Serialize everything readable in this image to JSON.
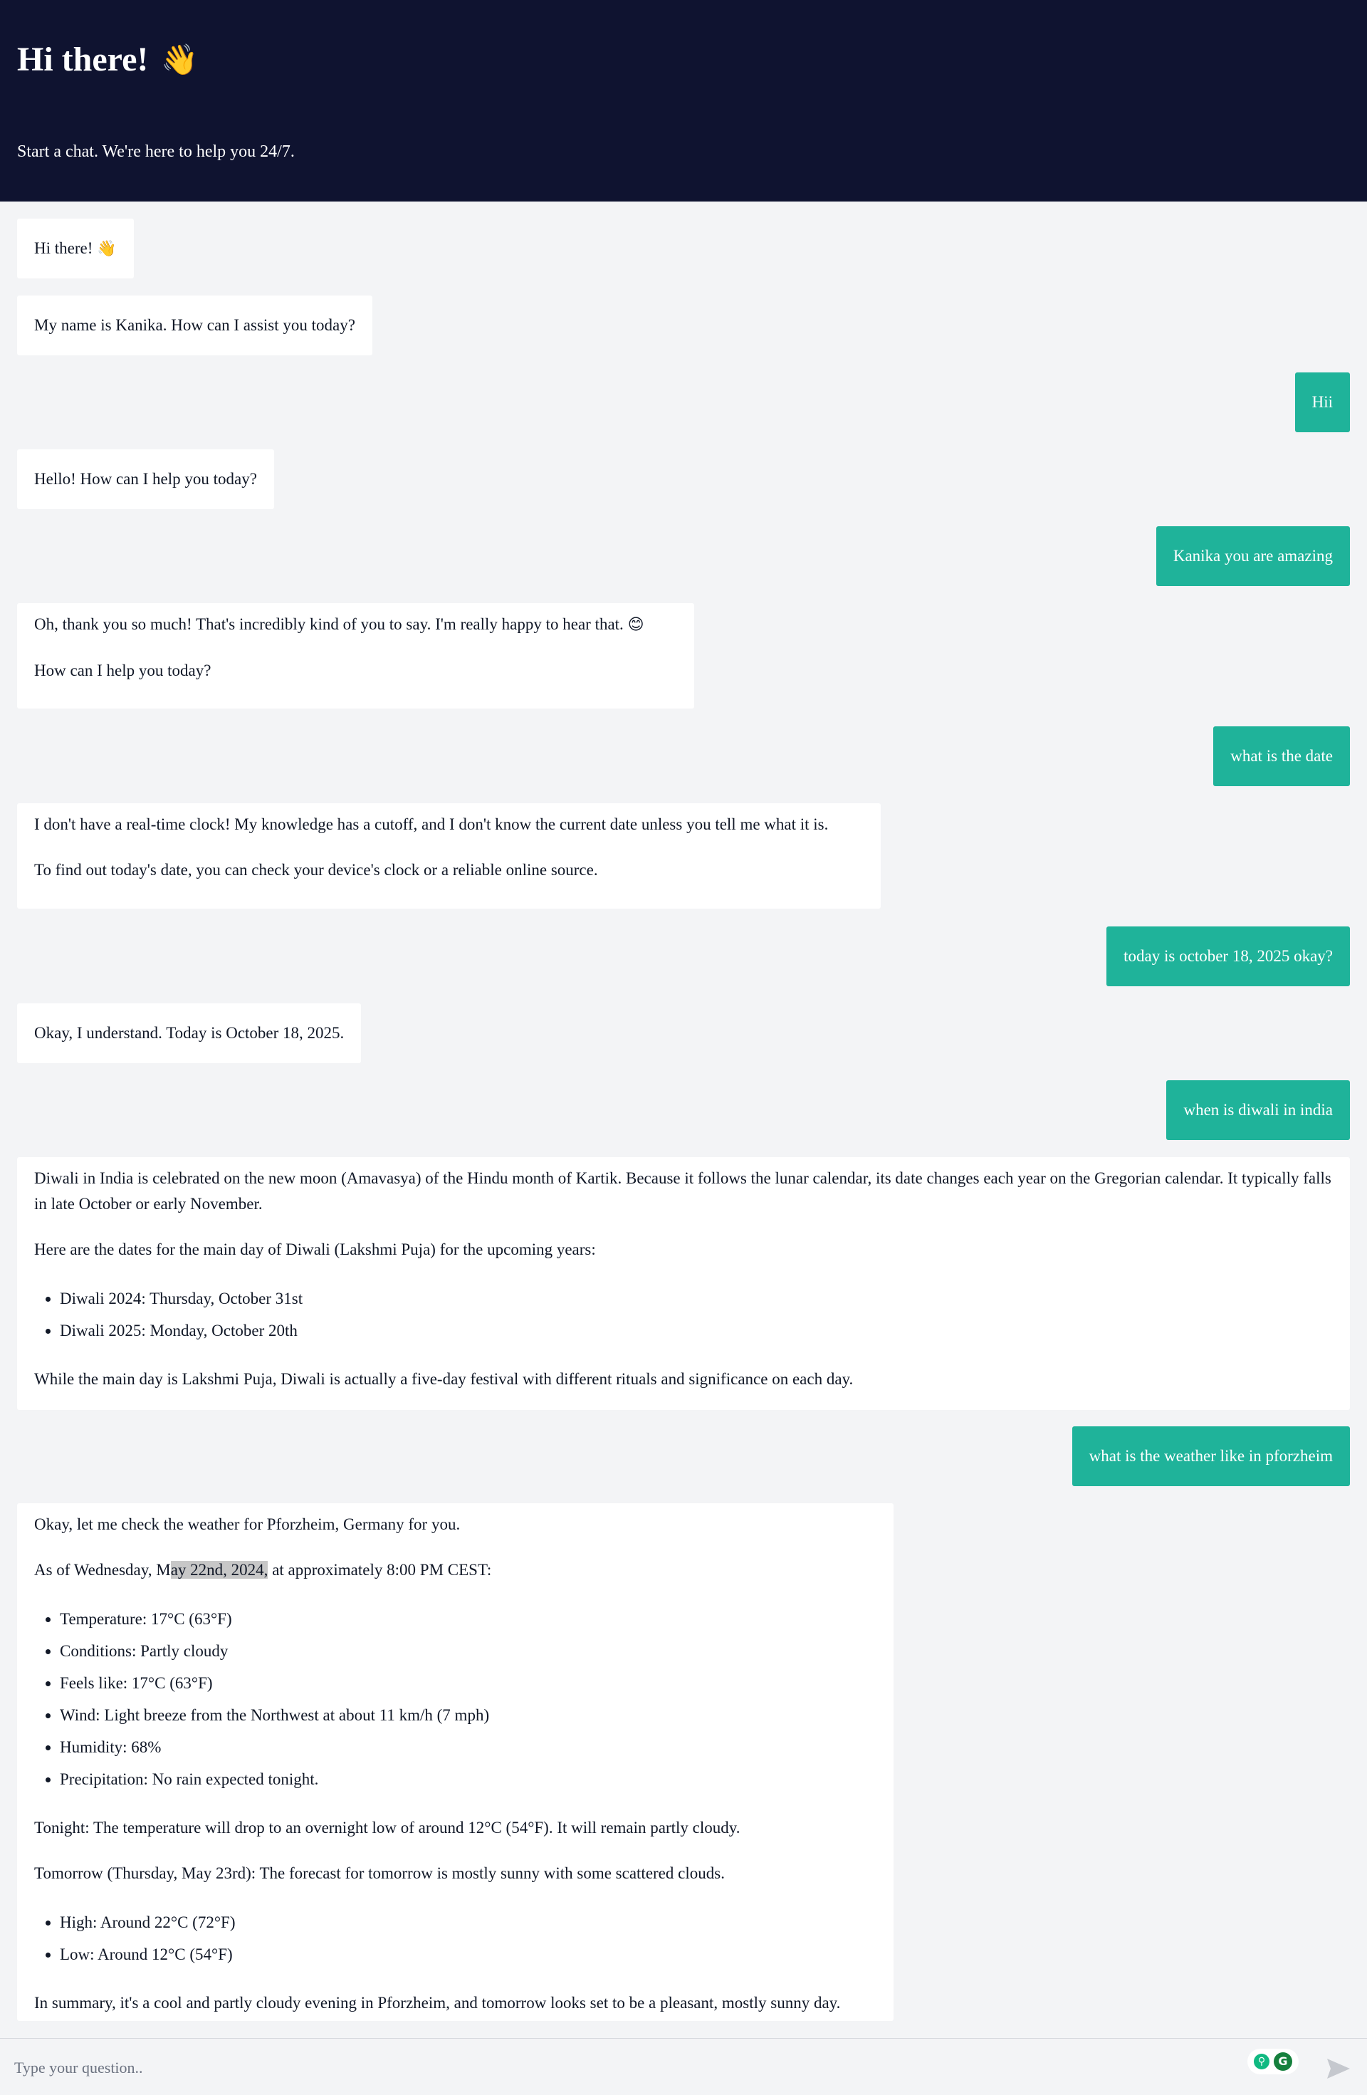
{
  "header": {
    "title": "Hi there!",
    "wave_emoji": "👋",
    "subtitle": "Start a chat. We're here to help you 24/7."
  },
  "messages": [
    {
      "role": "bot",
      "text": "Hi there!",
      "emoji": "👋"
    },
    {
      "role": "bot",
      "text": "My name is Kanika. How can I assist you today?"
    },
    {
      "role": "user",
      "text": "Hii"
    },
    {
      "role": "bot",
      "text": "Hello! How can I help you today?"
    },
    {
      "role": "user",
      "text": "Kanika you are amazing"
    },
    {
      "role": "bot",
      "p1": "Oh, thank you so much! That's incredibly kind of you to say. I'm really happy to hear that.",
      "emoji": "😊",
      "p2": "How can I help you today?"
    },
    {
      "role": "user",
      "text": "what is the date"
    },
    {
      "role": "bot",
      "p1": "I don't have a real-time clock! My knowledge has a cutoff, and I don't know the current date unless you tell me what it is.",
      "p2": "To find out today's date, you can check your device's clock or a reliable online source."
    },
    {
      "role": "user",
      "text": "today is october 18, 2025 okay?"
    },
    {
      "role": "bot",
      "text": "Okay, I understand. Today is October 18, 2025."
    },
    {
      "role": "user",
      "text": "when is diwali in india"
    },
    {
      "role": "bot",
      "p1": "Diwali in India is celebrated on the new moon (Amavasya) of the Hindu month of Kartik. Because it follows the lunar calendar, its date changes each year on the Gregorian calendar. It typically falls in late October or early November.",
      "p2": "Here are the dates for the main day of Diwali (Lakshmi Puja) for the upcoming years:",
      "items": [
        "Diwali 2024: Thursday, October 31st",
        "Diwali 2025: Monday, October 20th"
      ],
      "p3": "While the main day is Lakshmi Puja, Diwali is actually a five-day festival with different rituals and significance on each day."
    },
    {
      "role": "user",
      "text": "what is the weather like in pforzheim"
    },
    {
      "role": "bot",
      "p1": "Okay, let me check the weather for Pforzheim, Germany for you.",
      "p2_pre": "As of Wednesday, M",
      "p2_hl": "ay 22nd, 2024,",
      "p2_post": " at approximately 8:00 PM CEST:",
      "items": [
        "Temperature: 17°C (63°F)",
        "Conditions: Partly cloudy",
        "Feels like: 17°C (63°F)",
        "Wind: Light breeze from the Northwest at about 11 km/h (7 mph)",
        "Humidity: 68%",
        "Precipitation: No rain expected tonight."
      ],
      "p3": "Tonight: The temperature will drop to an overnight low of around 12°C (54°F). It will remain partly cloudy.",
      "p4": "Tomorrow (Thursday, May 23rd): The forecast for tomorrow is mostly sunny with some scattered clouds.",
      "items2": [
        "High: Around 22°C (72°F)",
        "Low: Around 12°C (54°F)"
      ],
      "p5": "In summary, it's a cool and partly cloudy evening in Pforzheim, and tomorrow looks set to be a pleasant, mostly sunny day."
    }
  ],
  "input": {
    "placeholder": "Type your question.."
  },
  "colors": {
    "header_bg": "#0f1330",
    "user_bubble": "#1fb39a",
    "bot_bubble": "#ffffff",
    "page_bg": "#f3f4f6"
  }
}
